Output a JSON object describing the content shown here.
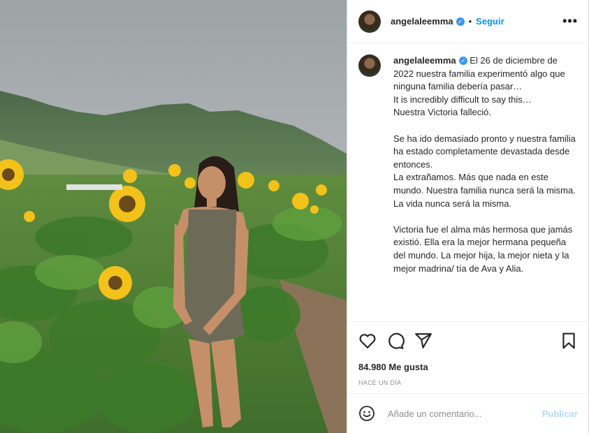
{
  "post": {
    "username": "angelaleemma",
    "verified_icon": "verified-badge-icon",
    "follow_label": "Seguir",
    "separator": "•",
    "more_icon": "more-options-icon",
    "more_label": "•••"
  },
  "caption": {
    "username": "angelaleemma",
    "text": " El 26 de diciembre de 2022 nuestra familia experimentó algo que ninguna familia debería pasar…\nIt is incredibly difficult to say this…\nNuestra Victoria falleció.\n\nSe ha ido demasiado pronto y nuestra familia ha estado completamente devastada desde entonces.\nLa extrañamos. Más que nada en este mundo. Nuestra familia nunca será la misma. La vida nunca será la misma.\n\nVictoria fue el alma más hermosa que jamás existió. Ella era la mejor hermana pequeña del mundo. La mejor hija, la mejor nieta y la mejor madrina/ tía de Ava y Alia."
  },
  "actions": {
    "icons": [
      "heart-icon",
      "comment-icon",
      "share-icon",
      "bookmark-icon"
    ]
  },
  "likes": "84.980 Me gusta",
  "timestamp": "HACE UN DÍA",
  "comment": {
    "placeholder": "Añade un comentario...",
    "publish_label": "Publicar",
    "emoji_icon": "emoji-icon"
  },
  "colors": {
    "link": "#0095f6",
    "publish_disabled": "#b3dbff",
    "border": "#dbdbdb"
  }
}
